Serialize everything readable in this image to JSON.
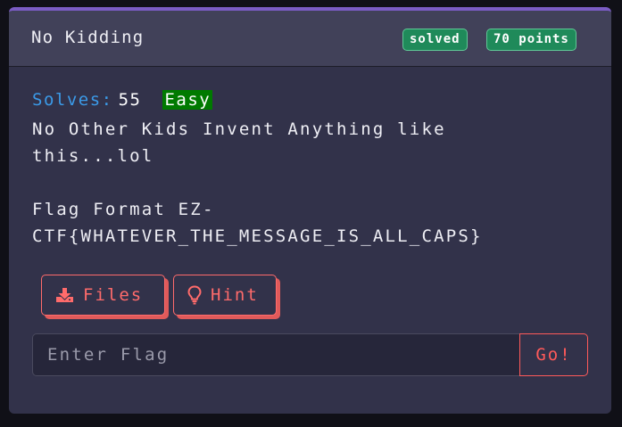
{
  "challenge": {
    "title": "No Kidding",
    "status_badge": "solved",
    "points_badge": "70 points",
    "solves_label": "Solves:",
    "solves_count": "55",
    "difficulty": "Easy",
    "description": "No Other Kids Invent Anything like\nthis...lol\n\nFlag Format EZ-\nCTF{WHATEVER_THE_MESSAGE_IS_ALL_CAPS}"
  },
  "actions": {
    "files_label": "Files",
    "files_icon": "download-icon",
    "hint_label": "Hint",
    "hint_icon": "lightbulb-icon"
  },
  "flag_form": {
    "value": "",
    "placeholder": "Enter Flag",
    "submit_label": "Go!"
  },
  "colors": {
    "accent_red": "#ff6b6b",
    "badge_green": "#1f8a5a",
    "difficulty_green": "#007a00",
    "solves_blue": "#3b9ae8",
    "card_top_border": "#7b5cc4"
  }
}
